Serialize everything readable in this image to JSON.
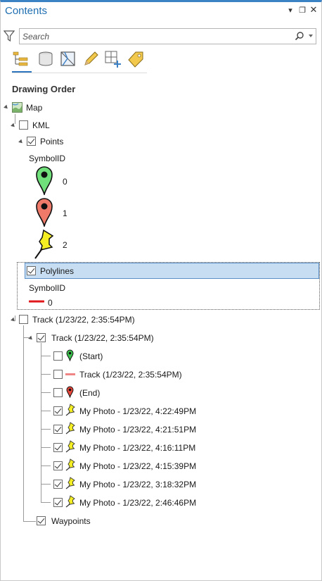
{
  "panel": {
    "title": "Contents",
    "controls": {
      "menu": "▾",
      "restore": "❐",
      "close": "✕"
    }
  },
  "search": {
    "placeholder": "Search",
    "value": ""
  },
  "toolbar": {
    "buttons": [
      "list-by-drawing-order",
      "list-by-source",
      "list-by-selection",
      "list-by-editing",
      "list-by-snapping",
      "list-by-labeling"
    ]
  },
  "section_title": "Drawing Order",
  "tree": {
    "map": "Map",
    "kml": "KML",
    "points": "Points",
    "points_field": "SymbolID",
    "point_symbols": [
      {
        "label": "0",
        "color": "#6fe07a"
      },
      {
        "label": "1",
        "color": "#f07a6a"
      },
      {
        "label": "2",
        "color": "#f4ee22"
      }
    ],
    "polylines": "Polylines",
    "polylines_field": "SymbolID",
    "polyline_symbol": {
      "label": "0",
      "color": "#e0181c"
    },
    "track_group": "Track (1/23/22, 2:35:54PM)",
    "track_sub": "Track (1/23/22, 2:35:54PM)",
    "track_items": [
      {
        "label": "(Start)",
        "checked": false,
        "icon": "green-pin"
      },
      {
        "label": "Track (1/23/22, 2:35:54PM)",
        "checked": false,
        "icon": "pink-line"
      },
      {
        "label": "(End)",
        "checked": false,
        "icon": "red-pin"
      },
      {
        "label": "My Photo - 1/23/22, 4:22:49PM",
        "checked": true,
        "icon": "yellow-pushpin"
      },
      {
        "label": "My Photo - 1/23/22, 4:21:51PM",
        "checked": true,
        "icon": "yellow-pushpin"
      },
      {
        "label": "My Photo - 1/23/22, 4:16:11PM",
        "checked": true,
        "icon": "yellow-pushpin"
      },
      {
        "label": "My Photo - 1/23/22, 4:15:39PM",
        "checked": true,
        "icon": "yellow-pushpin"
      },
      {
        "label": "My Photo - 1/23/22, 3:18:32PM",
        "checked": true,
        "icon": "yellow-pushpin"
      },
      {
        "label": "My Photo - 1/23/22, 2:46:46PM",
        "checked": true,
        "icon": "yellow-pushpin"
      }
    ],
    "waypoints": "Waypoints"
  },
  "colors": {
    "accent": "#1f6fb2",
    "selection": "#c7ddf1",
    "selection_border": "#5b8fc7"
  }
}
